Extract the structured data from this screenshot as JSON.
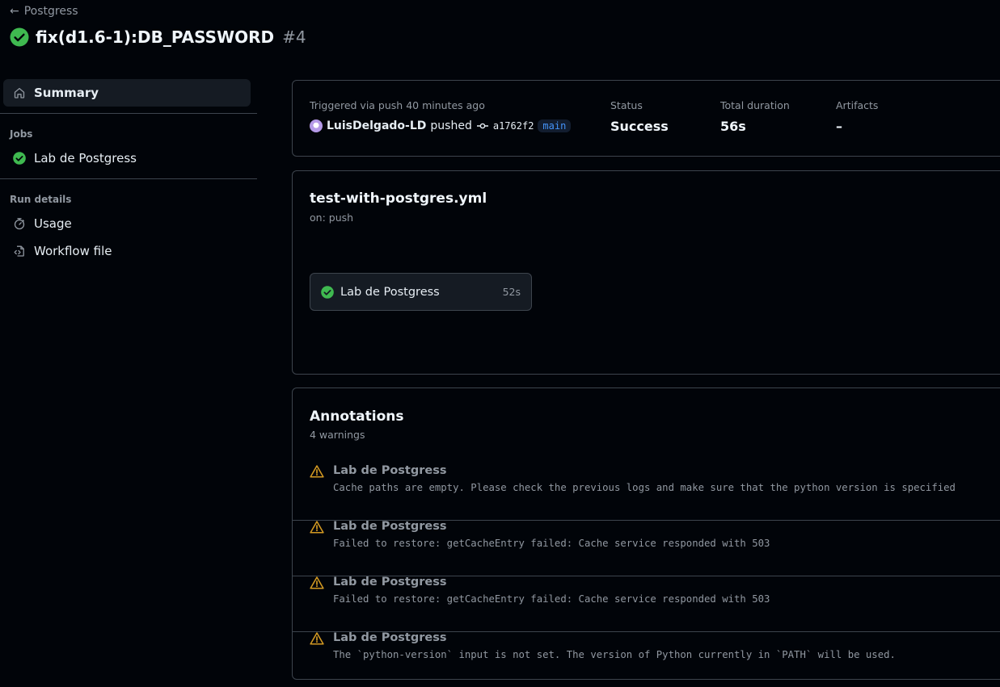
{
  "header": {
    "back_label": "Postgress",
    "run_title": "fix(d1.6-1):DB_PASSWORD",
    "run_number": "#4"
  },
  "sidebar": {
    "summary_label": "Summary",
    "jobs_heading": "Jobs",
    "jobs": [
      {
        "label": "Lab de Postgress",
        "status": "success"
      }
    ],
    "run_details_heading": "Run details",
    "usage_label": "Usage",
    "workflow_file_label": "Workflow file"
  },
  "summary": {
    "trigger_text": "Triggered via push 40 minutes ago",
    "actor": "LuisDelgado-LD",
    "action": "pushed",
    "commit_sha": "a1762f2",
    "branch": "main",
    "status_label": "Status",
    "status_value": "Success",
    "duration_label": "Total duration",
    "duration_value": "56s",
    "artifacts_label": "Artifacts",
    "artifacts_value": "–"
  },
  "workflow": {
    "file_name": "test-with-postgres.yml",
    "trigger": "on: push",
    "job": {
      "name": "Lab de Postgress",
      "duration": "52s",
      "status": "success"
    }
  },
  "annotations": {
    "title": "Annotations",
    "count_text": "4 warnings",
    "items": [
      {
        "job": "Lab de Postgress",
        "message": "Cache paths are empty. Please check the previous logs and make sure that the python version is specified"
      },
      {
        "job": "Lab de Postgress",
        "message": "Failed to restore: getCacheEntry failed: Cache service responded with 503"
      },
      {
        "job": "Lab de Postgress",
        "message": "Failed to restore: getCacheEntry failed: Cache service responded with 503"
      },
      {
        "job": "Lab de Postgress",
        "message": "The `python-version` input is not set. The version of Python currently in `PATH` will be used."
      }
    ]
  },
  "colors": {
    "success": "#3fb950",
    "warning": "#d29922",
    "link": "#4493f8",
    "background": "#010409",
    "border": "#3d444d"
  },
  "icons": {
    "back": "arrow-left-icon",
    "status": "check-circle-fill-icon",
    "summary": "home-icon",
    "usage": "stopwatch-icon",
    "workflow_file": "file-code-icon",
    "commit": "git-commit-icon",
    "warning": "alert-icon"
  }
}
